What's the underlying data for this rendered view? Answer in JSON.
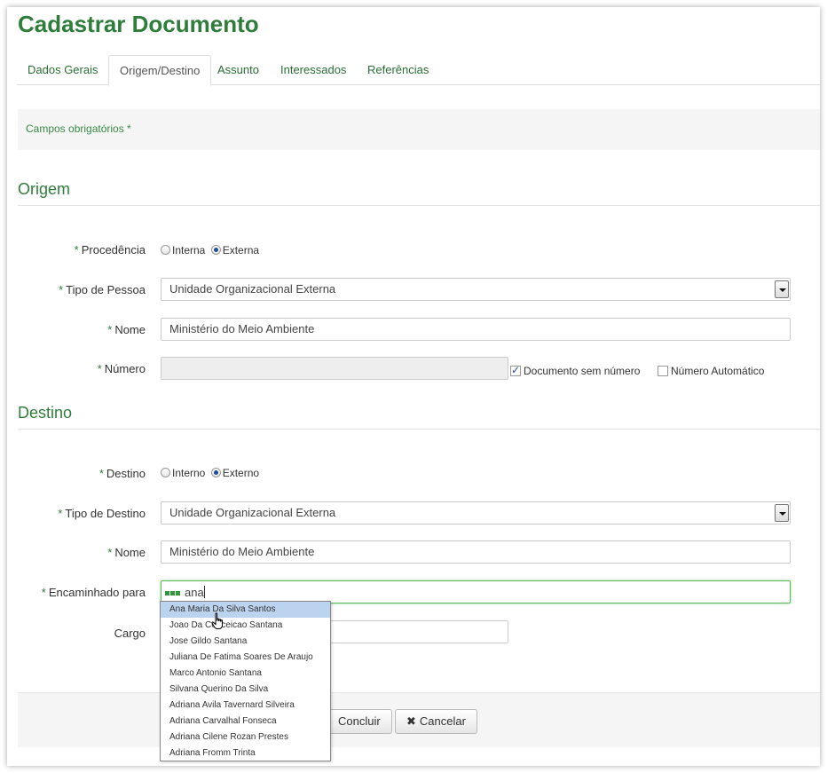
{
  "page_title": "Cadastrar Documento",
  "tabs": [
    {
      "label": "Dados Gerais",
      "active": false
    },
    {
      "label": "Origem/Destino",
      "active": true
    },
    {
      "label": "Assunto",
      "active": false
    },
    {
      "label": "Interessados",
      "active": false
    },
    {
      "label": "Referências",
      "active": false
    }
  ],
  "required_note": "Campos obrigatórios *",
  "required_star": "*",
  "origem": {
    "title": "Origem",
    "procedencia": {
      "label": "Procedência",
      "options": [
        "Interna",
        "Externa"
      ],
      "selected": "Externa"
    },
    "tipo_pessoa": {
      "label": "Tipo de Pessoa",
      "value": "Unidade Organizacional Externa"
    },
    "nome": {
      "label": "Nome",
      "value": "Ministério do Meio Ambiente"
    },
    "numero": {
      "label": "Número",
      "value": "",
      "sem_numero_label": "Documento sem número",
      "sem_numero_checked": true,
      "automatico_label": "Número Automático",
      "automatico_checked": false
    }
  },
  "destino": {
    "title": "Destino",
    "destino": {
      "label": "Destino",
      "options": [
        "Interno",
        "Externo"
      ],
      "selected": "Externo"
    },
    "tipo_destino": {
      "label": "Tipo de Destino",
      "value": "Unidade Organizacional Externa"
    },
    "nome": {
      "label": "Nome",
      "value": "Ministério do Meio Ambiente"
    },
    "encaminhado": {
      "label": "Encaminhado para",
      "value": "ana"
    },
    "cargo": {
      "label": "Cargo",
      "value": ""
    }
  },
  "suggestions": [
    "Ana Maria Da Silva Santos",
    "Joao Da Conceicao Santana",
    "Jose Gildo Santana",
    "Juliana De Fatima Soares De Araujo",
    "Marco Antonio Santana",
    "Silvana Querino Da Silva",
    "Adriana Avila Tavernard Silveira",
    "Adriana Carvalhal Fonseca",
    "Adriana Cilene Rozan Prestes",
    "Adriana Fromm Trinta"
  ],
  "buttons": {
    "concluir": "Concluir",
    "cancelar": "Cancelar",
    "cancel_icon": "✖"
  },
  "colors": {
    "accent": "#2f7d3a",
    "highlight": "#bcd3ef",
    "focus": "#5cb85c"
  }
}
